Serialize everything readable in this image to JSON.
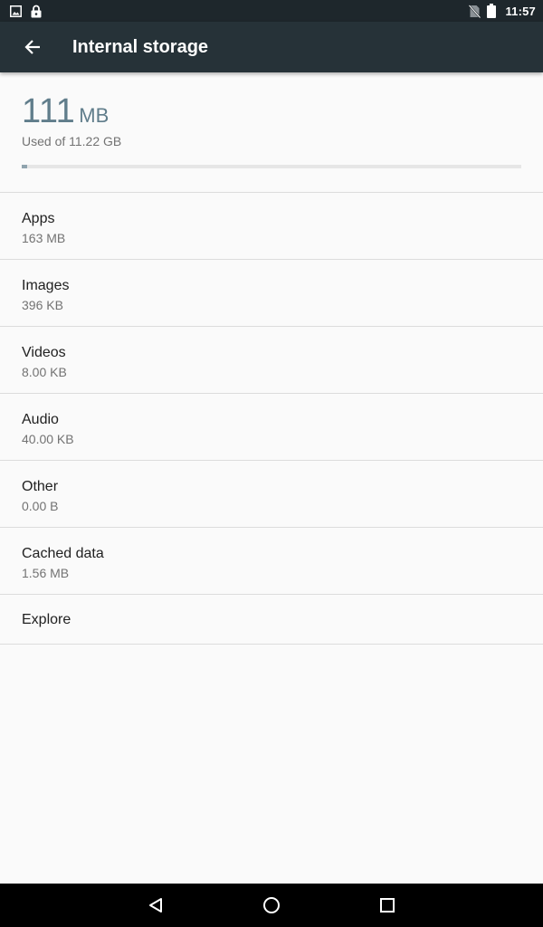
{
  "status_bar": {
    "time": "11:57",
    "left_icons": [
      "image-notification-icon",
      "lock-icon"
    ],
    "right_icons": [
      "no-sim-icon",
      "battery-icon"
    ]
  },
  "app_bar": {
    "title": "Internal storage",
    "back_icon": "arrow-back-icon"
  },
  "summary": {
    "used_value": "111",
    "used_unit": "MB",
    "caption": "Used of 11.22 GB",
    "used_fraction": 0.01
  },
  "categories": [
    {
      "label": "Apps",
      "size": "163 MB"
    },
    {
      "label": "Images",
      "size": "396 KB"
    },
    {
      "label": "Videos",
      "size": "8.00 KB"
    },
    {
      "label": "Audio",
      "size": "40.00 KB"
    },
    {
      "label": "Other",
      "size": "0.00 B"
    },
    {
      "label": "Cached data",
      "size": "1.56 MB"
    }
  ],
  "explore": {
    "label": "Explore"
  },
  "nav_bar": {
    "icons": [
      "back-triangle-icon",
      "home-circle-icon",
      "recents-square-icon"
    ]
  },
  "colors": {
    "status_bar": "#1e272c",
    "app_bar": "#263238",
    "accent": "#607d8b",
    "background": "#fafafa"
  }
}
